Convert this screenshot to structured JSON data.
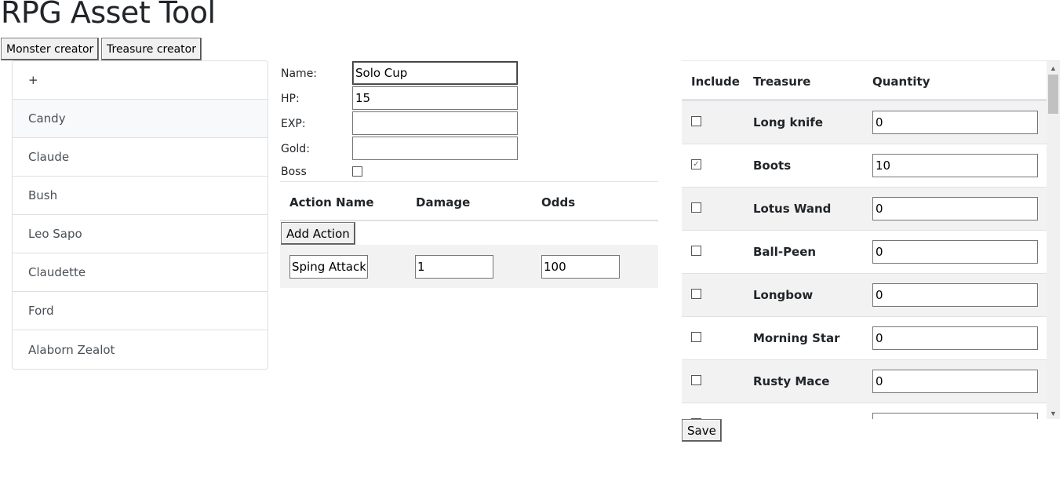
{
  "app": {
    "title": "RPG Asset Tool"
  },
  "tabs": {
    "monster": "Monster creator",
    "treasure": "Treasure creator"
  },
  "monsters": {
    "add_label": "+",
    "items": [
      "Candy",
      "Claude",
      "Bush",
      "Leo Sapo",
      "Claudette",
      "Ford",
      "Alaborn Zealot"
    ],
    "selected": "Candy"
  },
  "form": {
    "name_label": "Name:",
    "name_value": "Solo Cup",
    "hp_label": "HP:",
    "hp_value": "15",
    "exp_label": "EXP:",
    "exp_value": "",
    "gold_label": "Gold:",
    "gold_value": "",
    "boss_label": "Boss",
    "boss_checked": false
  },
  "actions": {
    "headers": {
      "name": "Action Name",
      "damage": "Damage",
      "odds": "Odds"
    },
    "add_label": "Add Action",
    "rows": [
      {
        "name": "Sping Attack",
        "damage": "1",
        "odds": "100"
      }
    ]
  },
  "treasure": {
    "headers": {
      "include": "Include",
      "treasure": "Treasure",
      "quantity": "Quantity"
    },
    "rows": [
      {
        "name": "Long knife",
        "included": false,
        "quantity": "0"
      },
      {
        "name": "Boots",
        "included": true,
        "quantity": "10"
      },
      {
        "name": "Lotus Wand",
        "included": false,
        "quantity": "0"
      },
      {
        "name": "Ball-Peen",
        "included": false,
        "quantity": "0"
      },
      {
        "name": "Longbow",
        "included": false,
        "quantity": "0"
      },
      {
        "name": "Morning Star",
        "included": false,
        "quantity": "0"
      },
      {
        "name": "Rusty Mace",
        "included": false,
        "quantity": "0"
      }
    ],
    "save_label": "Save"
  },
  "icons": {
    "check": "check-icon",
    "scroll_up": "chevron-up-icon",
    "scroll_down": "chevron-down-icon"
  }
}
